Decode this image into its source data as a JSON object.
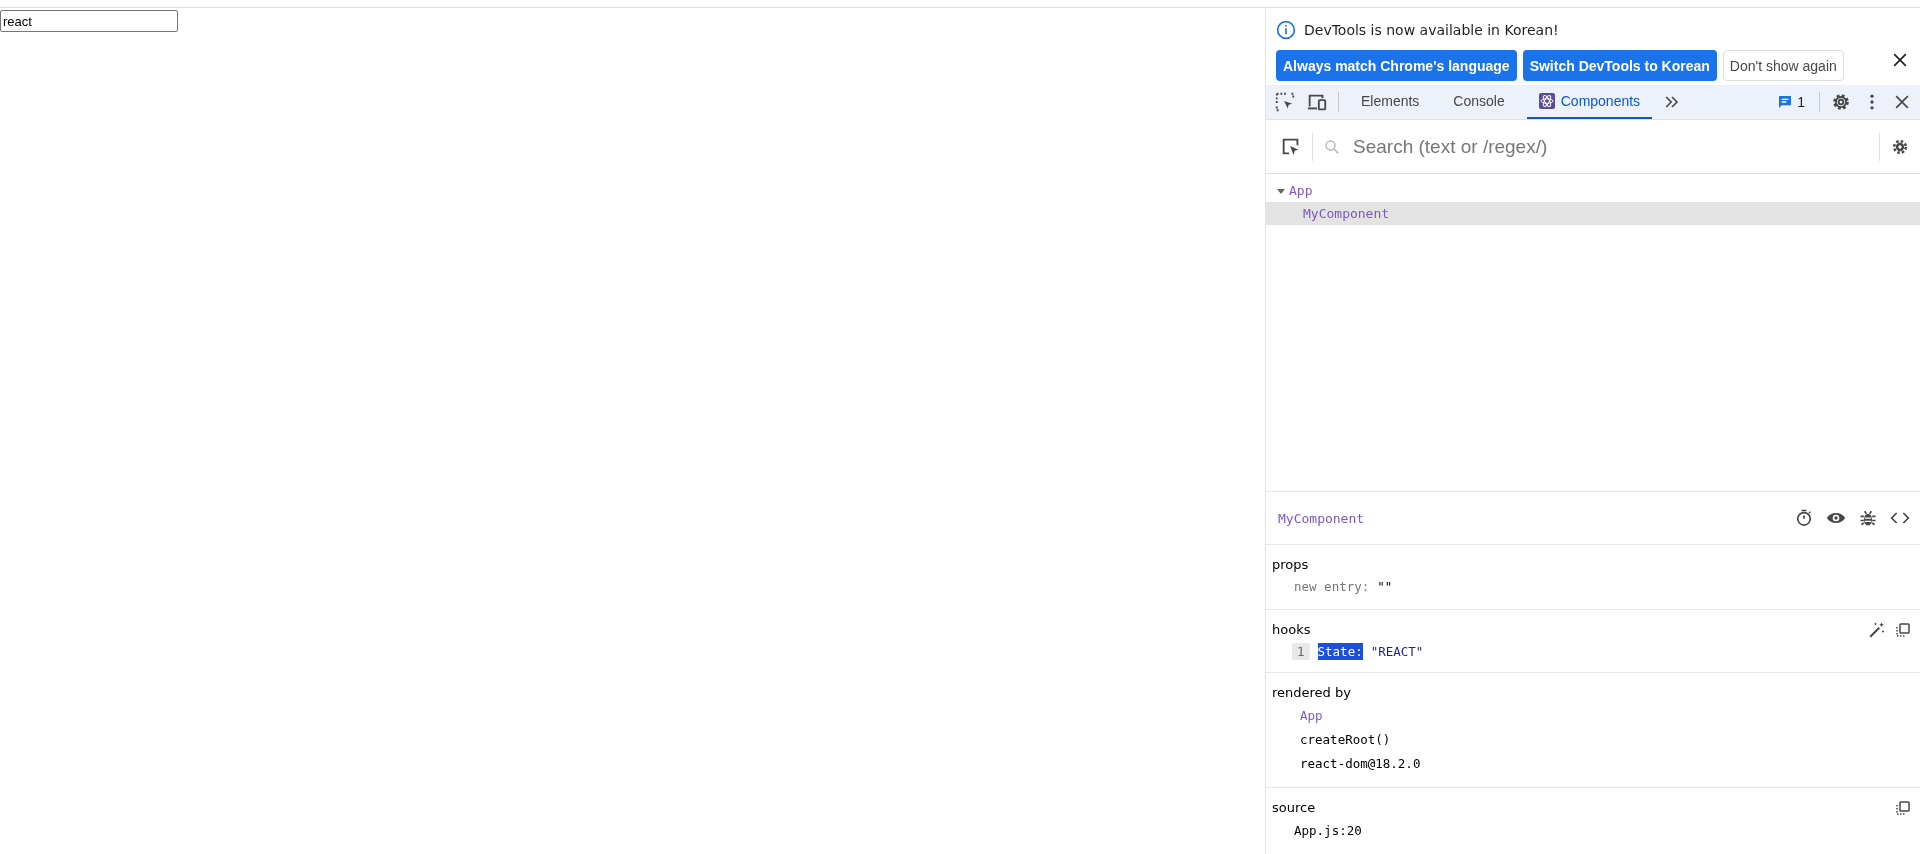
{
  "page": {
    "input_value": "react"
  },
  "devtools": {
    "infobar": {
      "message": "DevTools is now available in Korean!",
      "buttons": [
        {
          "label": "Always match Chrome's language",
          "kind": "primary"
        },
        {
          "label": "Switch DevTools to Korean",
          "kind": "primary"
        },
        {
          "label": "Don't show again",
          "kind": "secondary"
        }
      ]
    },
    "tabs": [
      {
        "label": "Elements",
        "selected": false
      },
      {
        "label": "Console",
        "selected": false
      },
      {
        "label": "Components",
        "selected": true
      }
    ],
    "issues_count": "1",
    "search": {
      "placeholder": "Search (text or /regex/)"
    },
    "tree": [
      {
        "name": "App",
        "expanded": true,
        "selected": false,
        "children": [
          {
            "name": "MyComponent",
            "selected": true
          }
        ]
      }
    ],
    "inspector": {
      "title": "MyComponent",
      "props": {
        "heading": "props",
        "items": [
          {
            "key": "new entry:",
            "value": "\"\""
          }
        ]
      },
      "hooks": {
        "heading": "hooks",
        "items": [
          {
            "index": "1",
            "key": "State:",
            "value": "\"REACT\"",
            "selected": true
          }
        ]
      },
      "rendered_by": {
        "heading": "rendered by",
        "items": [
          {
            "text": "App",
            "kind": "component"
          },
          {
            "text": "createRoot()",
            "kind": "plain"
          },
          {
            "text": "react-dom@18.2.0",
            "kind": "plain"
          }
        ]
      },
      "source": {
        "heading": "source",
        "location": "App.js:20"
      }
    }
  }
}
